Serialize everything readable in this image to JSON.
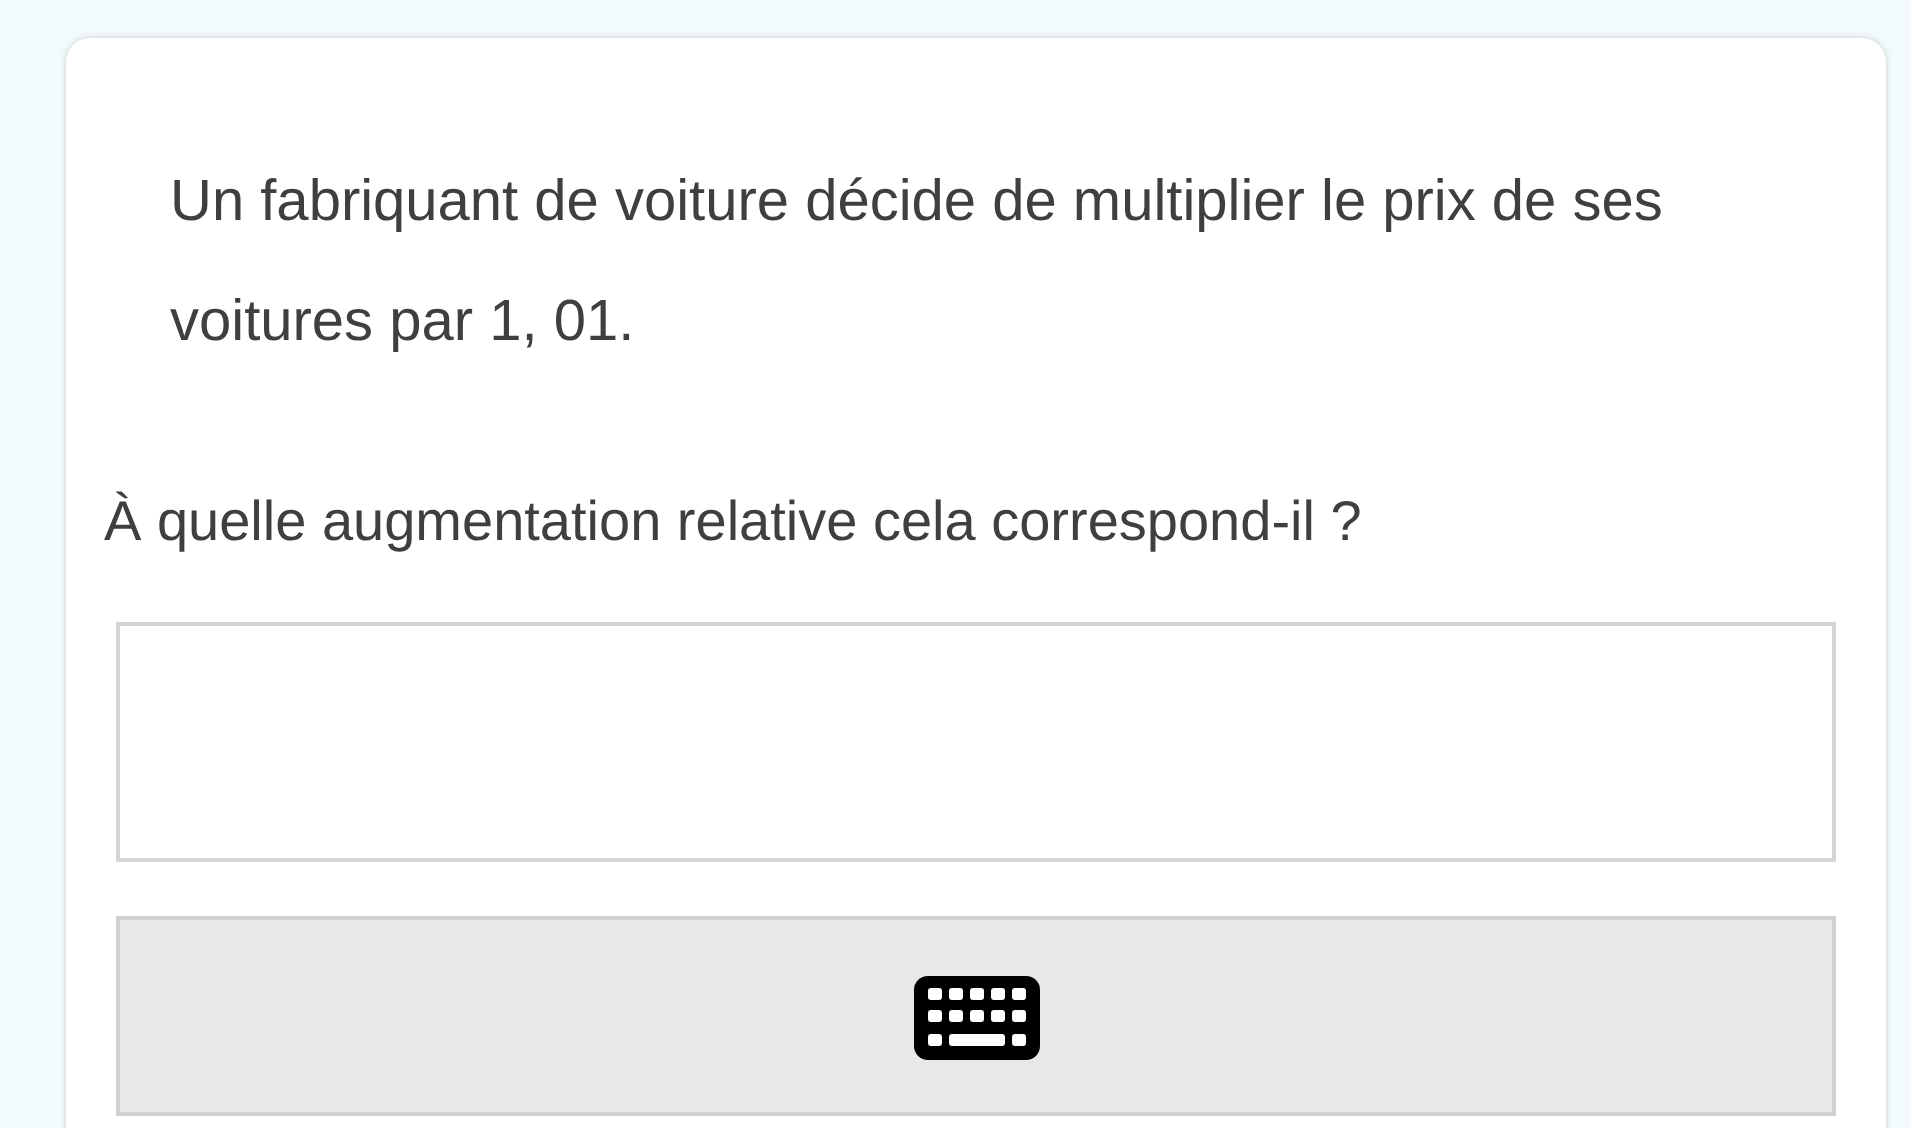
{
  "question": {
    "statement": "Un fabriquant de voiture décide de multiplier le prix de ses voitures par 1, 01.",
    "prompt": "À quelle augmentation relative cela correspond-il ?"
  }
}
